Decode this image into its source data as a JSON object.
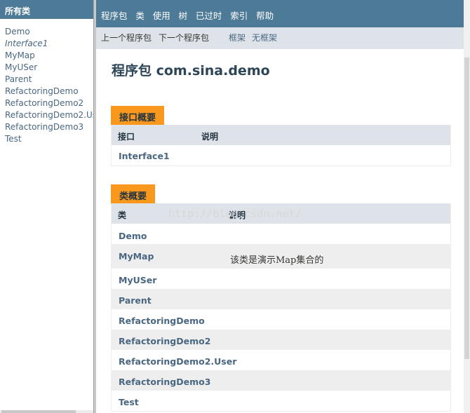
{
  "all_classes": {
    "header": "所有类",
    "items": [
      {
        "label": "Demo",
        "italic": false
      },
      {
        "label": "Interface1",
        "italic": true
      },
      {
        "label": "MyMap",
        "italic": false
      },
      {
        "label": "MyUSer",
        "italic": false
      },
      {
        "label": "Parent",
        "italic": false
      },
      {
        "label": "RefactoringDemo",
        "italic": false
      },
      {
        "label": "RefactoringDemo2",
        "italic": false
      },
      {
        "label": "RefactoringDemo2.User",
        "italic": false
      },
      {
        "label": "RefactoringDemo3",
        "italic": false
      },
      {
        "label": "Test",
        "italic": false
      }
    ]
  },
  "top_nav": {
    "items": [
      "程序包",
      "类",
      "使用",
      "树",
      "已过时",
      "索引",
      "帮助"
    ]
  },
  "sub_nav": {
    "prev_package": "上一个程序包",
    "next_package": "下一个程序包",
    "frames": "框架",
    "no_frames": "无框架"
  },
  "page": {
    "title": "程序包 com.sina.demo"
  },
  "interface_summary": {
    "caption": "接口概要",
    "col_name": "接口",
    "col_desc": "说明",
    "rows": [
      {
        "name": "Interface1",
        "desc": ""
      }
    ]
  },
  "class_summary": {
    "caption": "类概要",
    "col_name": "类",
    "col_desc": "说明",
    "rows": [
      {
        "name": "Demo",
        "desc": ""
      },
      {
        "name": "MyMap",
        "desc": "该类是演示Map集合的"
      },
      {
        "name": "MyUSer",
        "desc": ""
      },
      {
        "name": "Parent",
        "desc": ""
      },
      {
        "name": "RefactoringDemo",
        "desc": ""
      },
      {
        "name": "RefactoringDemo2",
        "desc": ""
      },
      {
        "name": "RefactoringDemo2.User",
        "desc": ""
      },
      {
        "name": "RefactoringDemo3",
        "desc": ""
      },
      {
        "name": "Test",
        "desc": ""
      }
    ]
  },
  "watermark": "http://blog.csdn.net/",
  "colors": {
    "nav_bar": "#4d7a97",
    "sub_nav": "#dee3e9",
    "caption": "#f8981d",
    "link": "#4a6782"
  }
}
